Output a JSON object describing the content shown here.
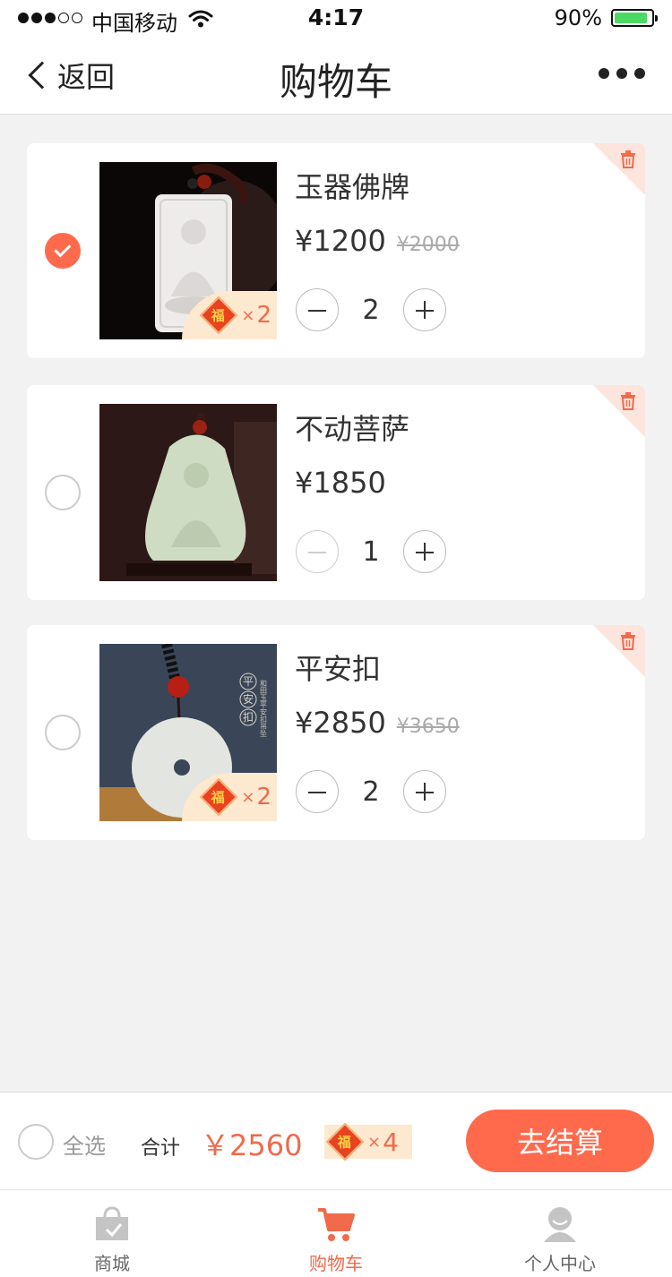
{
  "status_bar": {
    "carrier": "中国移动",
    "time": "4:17",
    "battery_percent": "90%",
    "battery_level": 0.9,
    "signal_bars_filled": 3,
    "signal_bars_total": 5
  },
  "nav": {
    "back_label": "返回",
    "title": "购物车"
  },
  "items": [
    {
      "name": "玉器佛牌",
      "price": "¥1200",
      "original_price": "¥2000",
      "quantity": "2",
      "selected": true,
      "fu_badge": {
        "symbol": "福",
        "x": "×",
        "count": "2"
      }
    },
    {
      "name": "不动菩萨",
      "price": "¥1850",
      "original_price": "",
      "quantity": "1",
      "selected": false,
      "minus_disabled": true
    },
    {
      "name": "平安扣",
      "price": "¥2850",
      "original_price": "¥3650",
      "quantity": "2",
      "selected": false,
      "fu_badge": {
        "symbol": "福",
        "x": "×",
        "count": "2"
      },
      "image_text": {
        "circles": [
          "平",
          "安",
          "扣"
        ],
        "vertical": "和田玉平安扣吊坠"
      }
    }
  ],
  "checkout_bar": {
    "select_all_label": "全选",
    "total_label": "合计",
    "total_amount": "￥2560",
    "fu_symbol": "福",
    "fu_x": "×",
    "fu_count": "4",
    "checkout_label": "去结算"
  },
  "tabs": [
    {
      "label": "商城",
      "icon": "shop-bag-icon",
      "active": false
    },
    {
      "label": "购物车",
      "icon": "cart-icon",
      "active": true
    },
    {
      "label": "个人中心",
      "icon": "user-icon",
      "active": false
    }
  ],
  "colors": {
    "accent": "#ff6a4d",
    "price_accent": "#f06a4b",
    "badge_bg": "#fde9cf",
    "delete_corner": "#fde4dc",
    "background": "#f2f2f2"
  }
}
